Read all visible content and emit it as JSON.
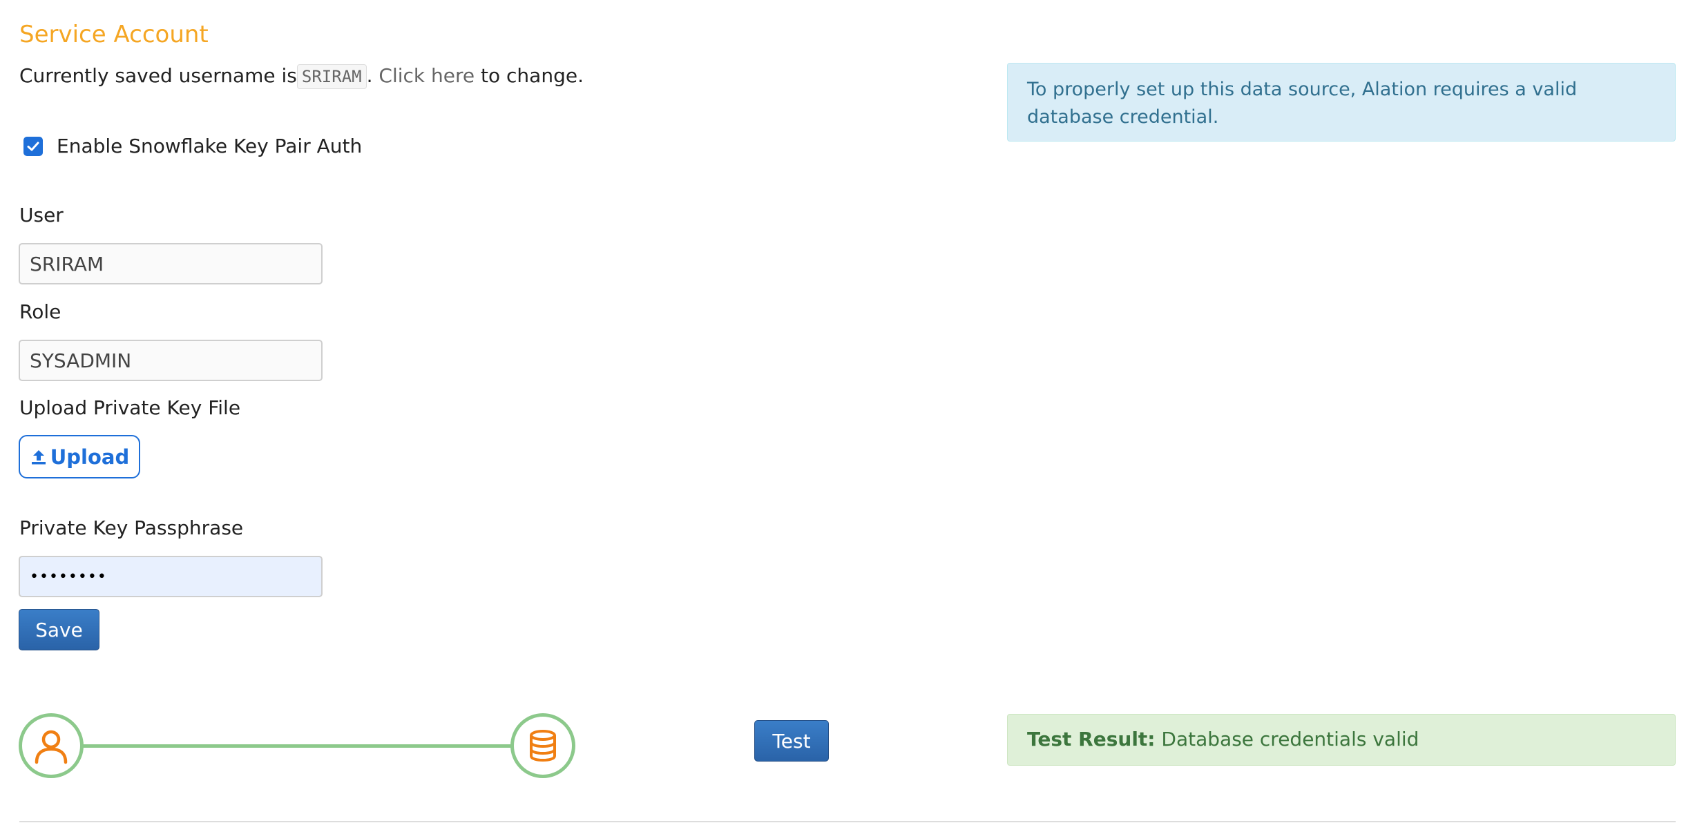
{
  "section": {
    "title": "Service Account"
  },
  "saved_username": {
    "prefix": "Currently saved username is",
    "username": "SRIRAM",
    "separator": ".",
    "link_text": "Click here",
    "suffix": "to change."
  },
  "info_alert": {
    "text": "To properly set up this data source, Alation requires a valid database credential."
  },
  "key_pair_auth": {
    "label": "Enable Snowflake Key Pair Auth",
    "checked": true
  },
  "form": {
    "user_label": "User",
    "user_value": "SRIRAM",
    "role_label": "Role",
    "role_value": "SYSADMIN",
    "upload_label": "Upload Private Key File",
    "upload_button": "Upload",
    "passphrase_label": "Private Key Passphrase",
    "passphrase_value": "••••••••",
    "save_button": "Save"
  },
  "connection_test": {
    "test_button": "Test",
    "result_label": "Test Result:",
    "result_text": "Database credentials valid",
    "user_icon": "user-icon",
    "database_icon": "database-icon"
  },
  "colors": {
    "title": "#f5a623",
    "accent_blue": "#1e6fd9",
    "button_blue": "#2a63a8",
    "success_green": "#8cc98b",
    "icon_orange": "#f07f13",
    "info_bg": "#d9edf7",
    "success_bg": "#dff0d8"
  }
}
